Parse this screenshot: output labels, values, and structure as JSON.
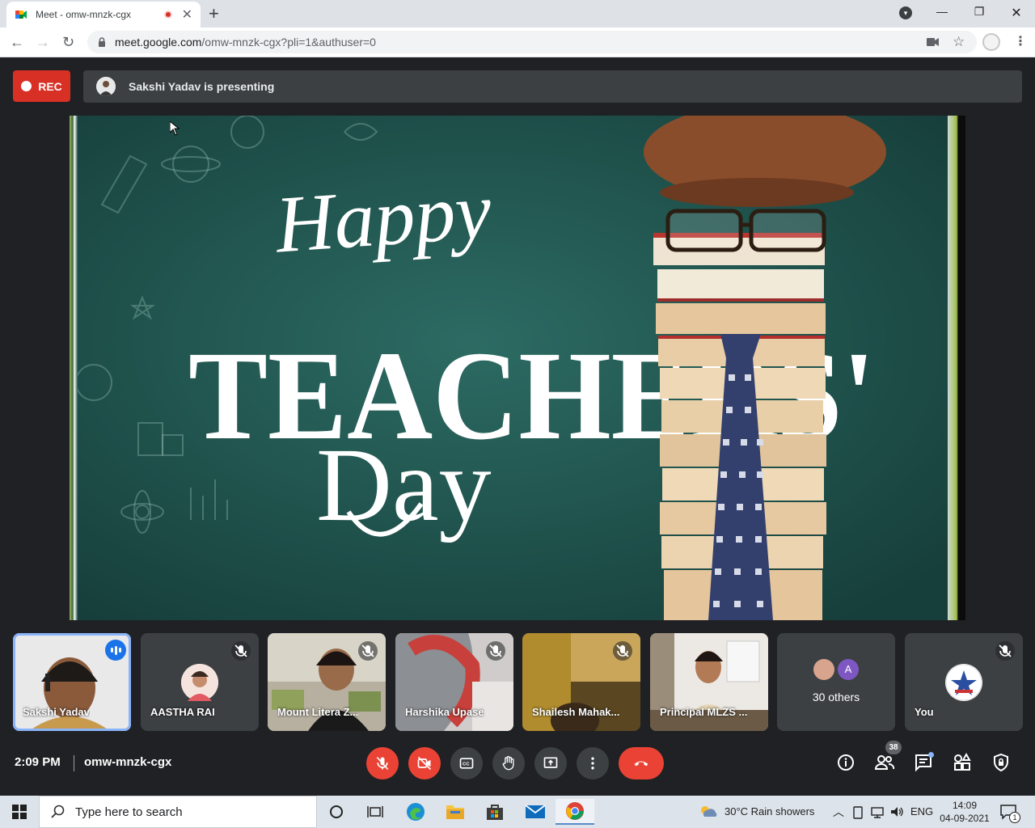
{
  "browser": {
    "tab_title": "Meet - omw-mnzk-cgx",
    "url_domain": "meet.google.com",
    "url_path": "/omw-mnzk-cgx?pli=1&authuser=0"
  },
  "meet": {
    "rec_label": "REC",
    "presenter_text": "Sakshi Yadav is presenting",
    "participants": [
      {
        "name": "Sakshi Yadav"
      },
      {
        "name": "AASTHA RAI"
      },
      {
        "name": "Mount Litera Z..."
      },
      {
        "name": "Harshika Upase"
      },
      {
        "name": "Shailesh Mahak..."
      },
      {
        "name": "Principal MLZS ..."
      },
      {
        "name": "30 others",
        "avatar_letter": "A"
      },
      {
        "name": "You"
      }
    ],
    "time": "2:09 PM",
    "meeting_code": "omw-mnzk-cgx",
    "people_count": "38"
  },
  "taskbar": {
    "search_placeholder": "Type here to search",
    "weather": "30°C  Rain showers",
    "language": "ENG",
    "clock_time": "14:09",
    "clock_date": "04-09-2021",
    "notification_count": "1"
  },
  "colors": {
    "meet_bg": "#202124",
    "rec_red": "#d93025",
    "active_outline": "#8ab4f8",
    "hangup_red": "#ea4335"
  }
}
